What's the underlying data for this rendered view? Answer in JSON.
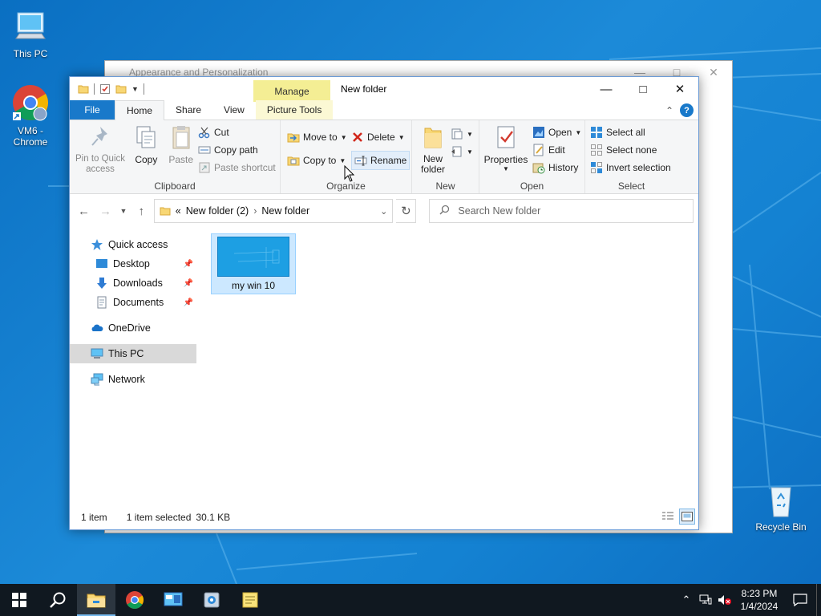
{
  "desktop": {
    "icons": [
      {
        "label": "This PC"
      },
      {
        "label": "VM6 -\nChrome"
      },
      {
        "label": "Recycle Bin"
      }
    ]
  },
  "bg_window": {
    "title": "Appearance and Personalization"
  },
  "window": {
    "title": "New folder",
    "context_tab": "Manage",
    "tabs": {
      "file": "File",
      "home": "Home",
      "share": "Share",
      "view": "View",
      "picture_tools": "Picture Tools"
    }
  },
  "ribbon": {
    "clipboard": {
      "label": "Clipboard",
      "pin_quick_access": "Pin to Quick access",
      "copy": "Copy",
      "paste": "Paste",
      "cut": "Cut",
      "copy_path": "Copy path",
      "paste_shortcut": "Paste shortcut"
    },
    "organize": {
      "label": "Organize",
      "move_to": "Move to",
      "copy_to": "Copy to",
      "delete": "Delete",
      "rename": "Rename"
    },
    "new": {
      "label": "New",
      "new_folder": "New folder"
    },
    "open": {
      "label": "Open",
      "properties": "Properties",
      "open": "Open",
      "edit": "Edit",
      "history": "History"
    },
    "select": {
      "label": "Select",
      "select_all": "Select all",
      "select_none": "Select none",
      "invert_selection": "Invert selection"
    }
  },
  "address": {
    "overflow": "«",
    "crumbs": [
      "New folder (2)",
      "New folder"
    ],
    "search_placeholder": "Search New folder"
  },
  "nav": {
    "quick_access": "Quick access",
    "desktop": "Desktop",
    "downloads": "Downloads",
    "documents": "Documents",
    "onedrive": "OneDrive",
    "this_pc": "This PC",
    "network": "Network"
  },
  "files": [
    {
      "name": "my win 10",
      "selected": true
    }
  ],
  "status": {
    "count": "1 item",
    "selection": "1 item selected",
    "size": "30.1 KB"
  },
  "taskbar": {
    "time": "8:23 PM",
    "date": "1/4/2024"
  },
  "colors": {
    "accent": "#1979ca",
    "manage_tab": "#f4ee94",
    "selection": "#cce8ff",
    "desktop": "#0a74c9",
    "taskbar": "#101820"
  }
}
